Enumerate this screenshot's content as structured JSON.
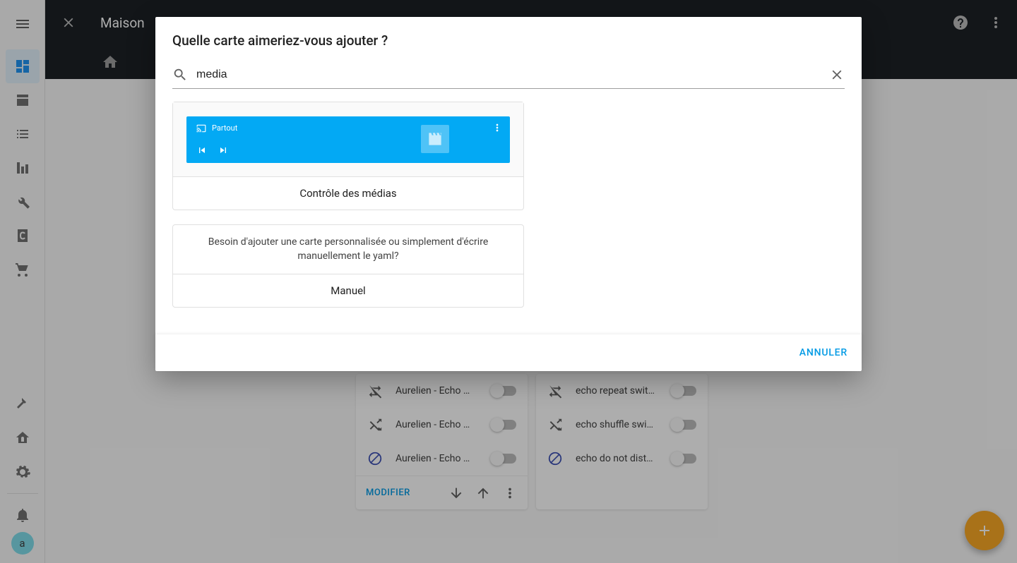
{
  "header": {
    "title": "Maison"
  },
  "avatar_letter": "a",
  "dialog": {
    "title": "Quelle carte aimeriez-vous ajouter ?",
    "search_value": "media",
    "media_card": {
      "device_label": "Partout",
      "caption": "Contrôle des médias"
    },
    "manual_card": {
      "description": "Besoin d'ajouter une carte personnalisée ou simplement d'écrire manuellement le yaml?",
      "caption": "Manuel"
    },
    "cancel": "ANNULER"
  },
  "bg": {
    "modifier": "MODIFIER",
    "card1": {
      "rows": [
        "Aurelien - Echo …",
        "Aurelien - Echo …",
        "Aurelien - Echo …"
      ]
    },
    "card2": {
      "rows": [
        "echo repeat swit…",
        "echo shuffle swi…",
        "echo do not dist…"
      ]
    }
  }
}
